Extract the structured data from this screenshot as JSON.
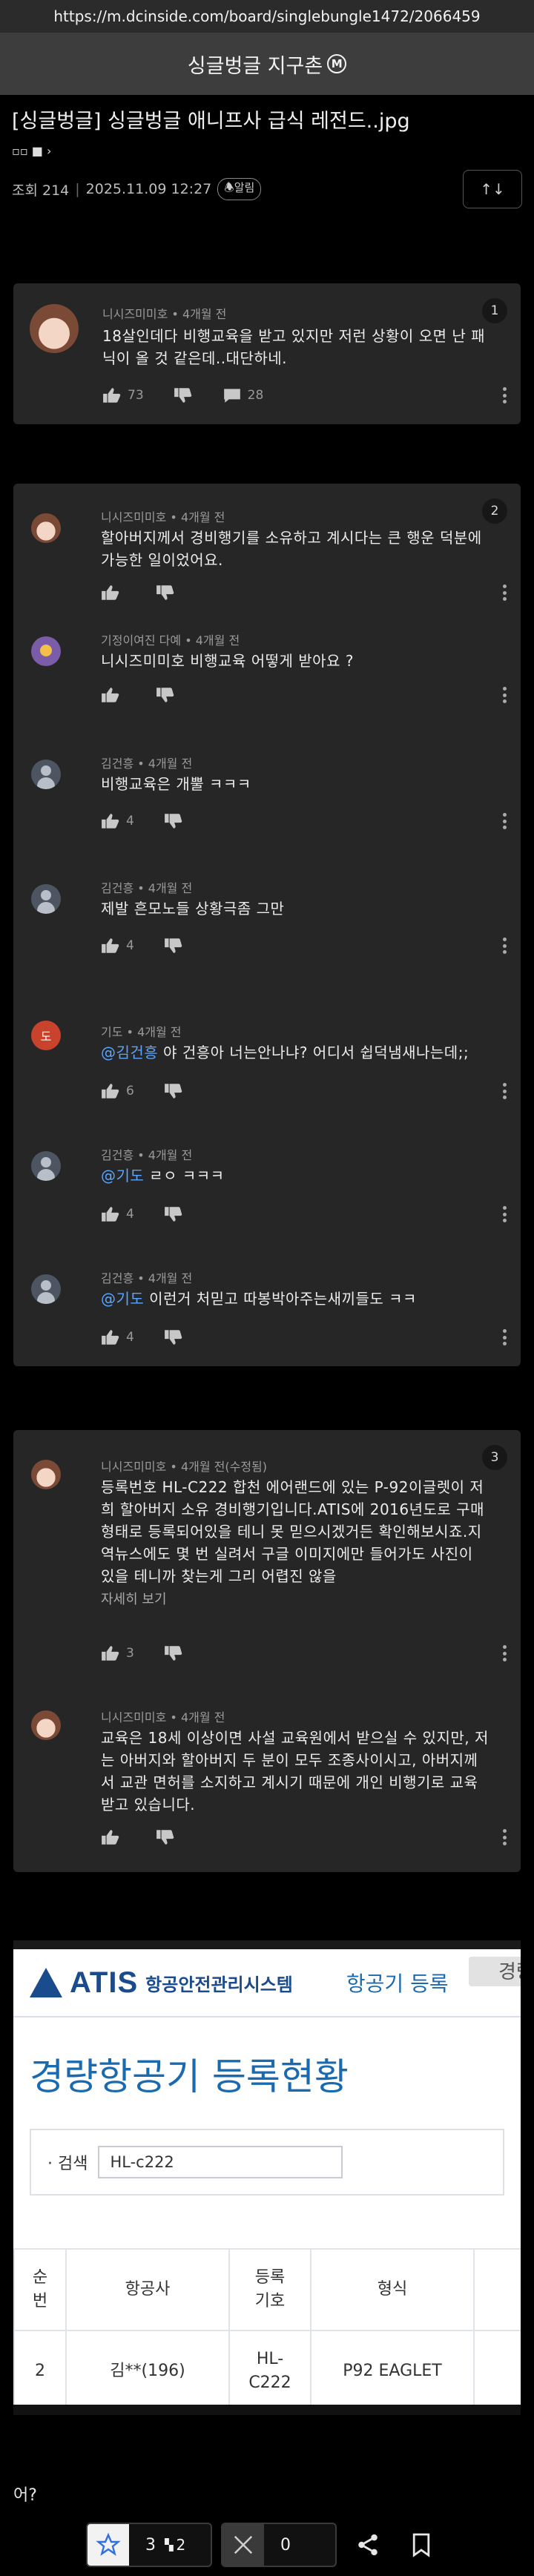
{
  "browser": {
    "url": "https://m.dcinside.com/board/singlebungle1472/2066459"
  },
  "gallery": {
    "title": "싱글벙글 지구촌",
    "minor_mark": "M"
  },
  "post": {
    "title": "[싱글벙글] 싱글벙글 애니프사 급식 레전드..jpg",
    "icons_label": "▫▫ ■ ›",
    "meta_views": "조회 214",
    "meta_date": "2025.11.09 12:27",
    "meta_alarm": "알림",
    "sort_label": "↑↓"
  },
  "threads": [
    {
      "number": "1",
      "comments": [
        {
          "author": "니시즈미미호",
          "time": "4개월 전",
          "text": "18살인데다 비행교육을 받고 있지만 저런 상황이 오면 난 패닉이 올 것 같은데..대단하네.",
          "likes": "73",
          "replies": "28",
          "avatar": "anime"
        }
      ]
    },
    {
      "number": "2",
      "comments": [
        {
          "author": "니시즈미미호",
          "time": "4개월 전",
          "text": "할아버지께서 경비행기를 소유하고 계시다는 큰 행운 덕분에 가능한 일이었어요.",
          "likes": "",
          "avatar": "anime"
        },
        {
          "author": "기정이여진 다예",
          "time": "4개월 전",
          "text": "니시즈미미호 비행교육 어떻게 받아요 ?",
          "likes": "",
          "avatar": "purple"
        },
        {
          "author": "김건흥",
          "time": "4개월 전",
          "text": "비행교육은 개뿔 ㅋㅋㅋ",
          "likes": "4",
          "avatar": "gray"
        },
        {
          "author": "김건흥",
          "time": "4개월 전",
          "text": "제발 흔모노들 상황극좀 그만",
          "likes": "4",
          "avatar": "gray"
        },
        {
          "author": "기도",
          "time": "4개월 전",
          "mention": "@김건흥",
          "text": " 야 건흥아 너는안나냐? 어디서 쉽덕냄새나는데;;",
          "likes": "6",
          "avatar": "red",
          "avatar_letter": "도"
        },
        {
          "author": "김건흥",
          "time": "4개월 전",
          "mention": "@기도",
          "text": " ㄹㅇ ㅋㅋㅋ",
          "likes": "4",
          "avatar": "gray"
        },
        {
          "author": "김건흥",
          "time": "4개월 전",
          "mention": "@기도",
          "text": " 이런거 처믿고 따봉박아주는새끼들도 ㅋㅋ",
          "likes": "4",
          "avatar": "gray"
        }
      ]
    },
    {
      "number": "3",
      "comments": [
        {
          "author": "니시즈미미호",
          "time": "4개월 전(수정됨)",
          "text": "등록번호 HL-C222 합천 에어랜드에 있는 P-92이글렛이 저희 할아버지 소유 경비행기입니다.ATIS에 2016년도로 구매 형태로 등록되어있을 테니 못 믿으시겠거든 확인해보시죠.지역뉴스에도 몇 번 실려서 구글 이미지에만 들어가도 사진이 있을 테니까 찾는게 그리 어렵진 않을",
          "more": "자세히 보기",
          "likes": "3",
          "avatar": "anime"
        },
        {
          "author": "니시즈미미호",
          "time": "4개월 전",
          "text": "교육은 18세 이상이면 사설 교육원에서 받으실 수 있지만, 저는 아버지와 할아버지 두 분이 모두 조종사이시고, 아버지께서 교관 면허를 소지하고 계시기 때문에 개인 비행기로 교육받고 있습니다.",
          "likes": "",
          "avatar": "anime"
        }
      ]
    }
  ],
  "atis": {
    "logo": "ATIS",
    "logo_sub": "항공안전관리시스템",
    "menu": "항공기 등록",
    "menu_next": "경량",
    "page_title": "경량항공기 등록현황",
    "search_label": "· 검색",
    "search_value": "HL-c222",
    "headers": [
      "순\n번",
      "항공사",
      "등록\n기호",
      "형식"
    ],
    "row": [
      "2",
      "김**(196)",
      "HL-\nC222",
      "P92 EAGLET"
    ]
  },
  "footer": {
    "text": "어?"
  },
  "bottom_bar": {
    "upvotes": "3",
    "fixed_upvotes": "2",
    "downvotes": "0"
  }
}
